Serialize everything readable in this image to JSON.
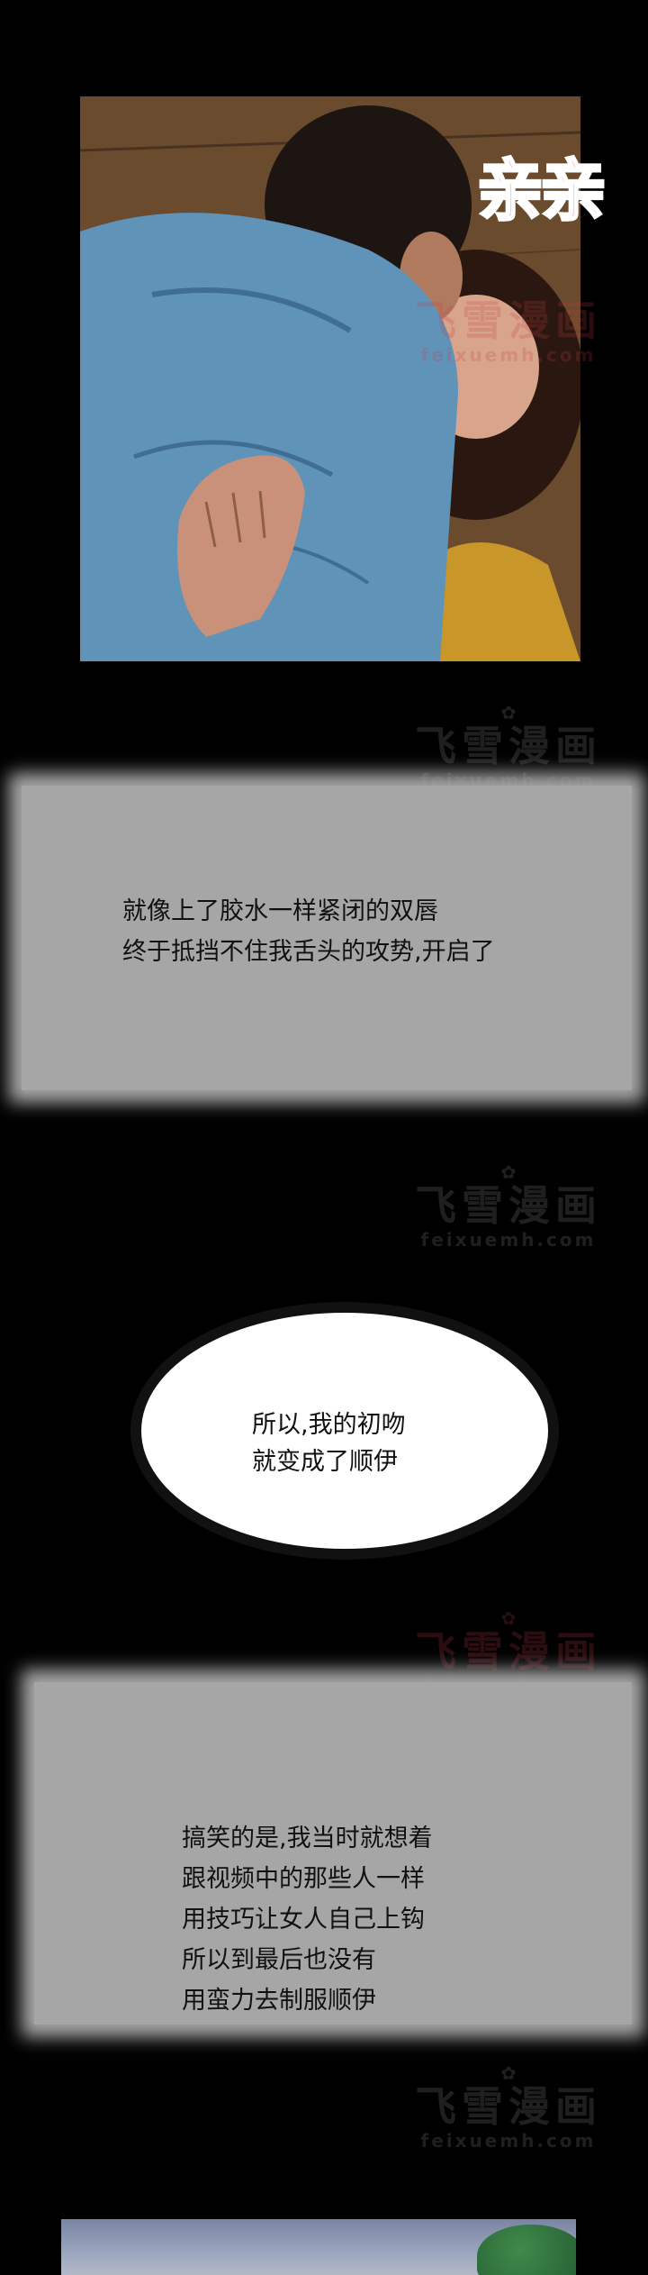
{
  "panels": {
    "kiss": {
      "sfx": "亲亲"
    }
  },
  "narration_1": {
    "text": "就像上了胶水一样紧闭的双唇\n终于抵挡不住我舌头的攻势,开启了"
  },
  "thought_bubble": {
    "text": "所以,我的初吻\n就变成了顺伊"
  },
  "narration_2": {
    "text": "搞笑的是,我当时就想着\n跟视频中的那些人一样\n用技巧让女人自己上钩\n所以到最后也没有\n用蛮力去制服顺伊"
  },
  "watermark": {
    "title": "飞雪漫画",
    "url": "feixuemh.com"
  }
}
